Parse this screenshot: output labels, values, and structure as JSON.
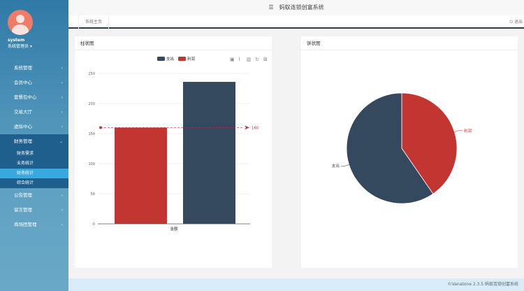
{
  "app": {
    "title": "蚂蚁连锁创富系统",
    "menu_icon": "hamburger-icon"
  },
  "user": {
    "name": "system",
    "role": "系统管理员 ▾"
  },
  "sidebar": {
    "items": [
      {
        "label": "系统管理"
      },
      {
        "label": "会员中心"
      },
      {
        "label": "套餐包中心"
      },
      {
        "label": "交易大厅"
      },
      {
        "label": "虚拟中心"
      },
      {
        "label": "财务管理",
        "open": true,
        "children": [
          {
            "label": "财务需求"
          },
          {
            "label": "业务统计"
          },
          {
            "label": "财务统计",
            "active": true
          },
          {
            "label": "综合统计"
          }
        ]
      },
      {
        "label": "公告管理"
      },
      {
        "label": "留言管理"
      },
      {
        "label": "商场团管理"
      }
    ]
  },
  "tabs": {
    "home": "系统主页",
    "exit": "退出"
  },
  "panels": {
    "bar_title": "柱状图",
    "pie_title": "饼状图"
  },
  "footer": "©Vanatone 2.3.5 蚂蚁连锁创富系统",
  "colors": {
    "dark": "#34495e",
    "red": "#c23531"
  },
  "chart_data": [
    {
      "type": "bar",
      "categories": [
        "金额"
      ],
      "series": [
        {
          "name": "利润",
          "values": [
            160
          ],
          "color": "#c23531"
        },
        {
          "name": "支出",
          "values": [
            236
          ],
          "color": "#34495e"
        }
      ],
      "legend": [
        "支出",
        "利润"
      ],
      "yticks": [
        0,
        50,
        100,
        150,
        200,
        250
      ],
      "ylim": [
        0,
        250
      ],
      "markline": {
        "value": 160,
        "label": "160"
      }
    },
    {
      "type": "pie",
      "slices": [
        {
          "name": "利润",
          "value": 160,
          "color": "#c23531"
        },
        {
          "name": "支出",
          "value": 236,
          "color": "#34495e"
        }
      ]
    }
  ]
}
